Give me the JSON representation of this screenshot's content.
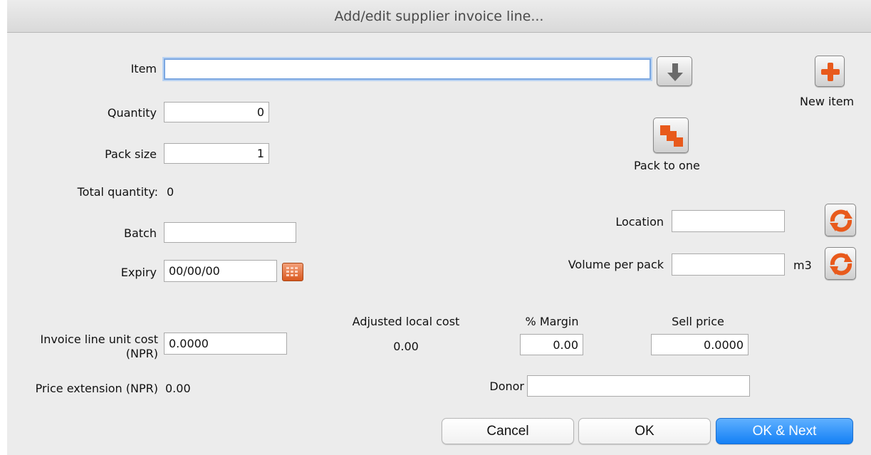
{
  "window": {
    "title": "Add/edit supplier invoice line..."
  },
  "item": {
    "label": "Item",
    "value": ""
  },
  "quantity": {
    "label": "Quantity",
    "value": "0"
  },
  "pack_size": {
    "label": "Pack size",
    "value": "1"
  },
  "total_quantity": {
    "label": "Total quantity:",
    "value": "0"
  },
  "batch": {
    "label": "Batch",
    "value": ""
  },
  "expiry": {
    "label": "Expiry",
    "value": "00/00/00"
  },
  "new_item": {
    "label": "New item"
  },
  "pack_to_one": {
    "label": "Pack to one"
  },
  "location": {
    "label": "Location",
    "value": ""
  },
  "volume_per_pack": {
    "label": "Volume per pack",
    "value": "",
    "unit": "m3"
  },
  "unit_cost": {
    "label_line1": "Invoice line unit cost",
    "label_line2": "(NPR)",
    "value": "0.0000"
  },
  "adjusted_local_cost": {
    "label": "Adjusted local cost",
    "value": "0.00"
  },
  "margin": {
    "label": "% Margin",
    "value": "0.00"
  },
  "sell_price": {
    "label": "Sell price",
    "value": "0.0000"
  },
  "price_extension": {
    "label": "Price extension (NPR)",
    "value": "0.00"
  },
  "donor": {
    "label": "Donor",
    "value": ""
  },
  "buttons": {
    "cancel": "Cancel",
    "ok": "OK",
    "ok_next": "OK & Next"
  },
  "colors": {
    "accent_blue": "#1480f5",
    "icon_orange": "#e85a1c"
  },
  "icons": {
    "item_lookup": "arrow-down-icon",
    "new_item": "plus-icon",
    "pack_to_one": "pack-to-one-icon",
    "calendar": "calendar-icon",
    "refresh": "refresh-icon"
  }
}
